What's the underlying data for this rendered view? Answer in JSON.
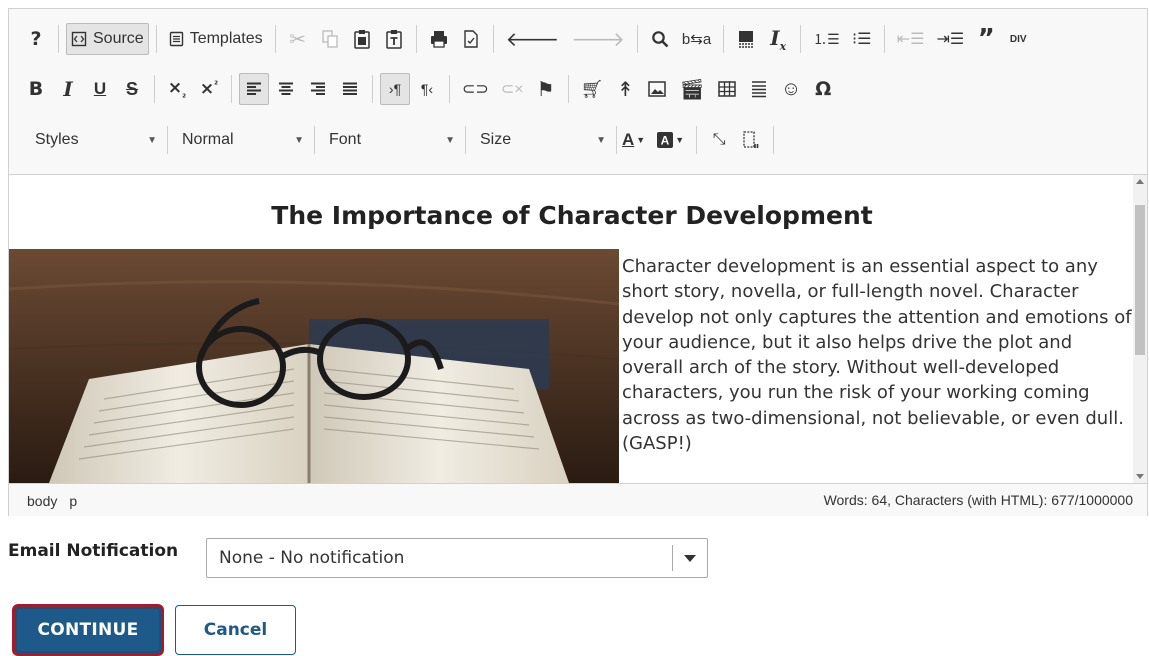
{
  "toolbar": {
    "row1": {
      "source_label": "Source",
      "templates_label": "Templates",
      "div_label": "DIV"
    },
    "combos": {
      "styles": "Styles",
      "format": "Normal",
      "font": "Font",
      "size": "Size"
    }
  },
  "document": {
    "title": "The Importance of Character Development",
    "body": "Character development is an essential aspect to any short story, novella, or full-length novel. Character develop not only captures the attention and emotions of your audience, but it also helps drive the plot and overall arch of the story. Without well-developed characters, you run the risk of your working coming across as two-dimensional, not believable, or even dull. (GASP!)",
    "image_icon": "book-and-glasses-photo"
  },
  "statusbar": {
    "path": [
      "body",
      "p"
    ],
    "counter": "Words: 64, Characters (with HTML): 677/1000000"
  },
  "email": {
    "label": "Email Notification",
    "selected": "None - No notification"
  },
  "actions": {
    "continue_label": "CONTINUE",
    "cancel_label": "Cancel"
  },
  "colors": {
    "primary": "#1d5a8a",
    "focus_ring": "#a31c2c"
  }
}
